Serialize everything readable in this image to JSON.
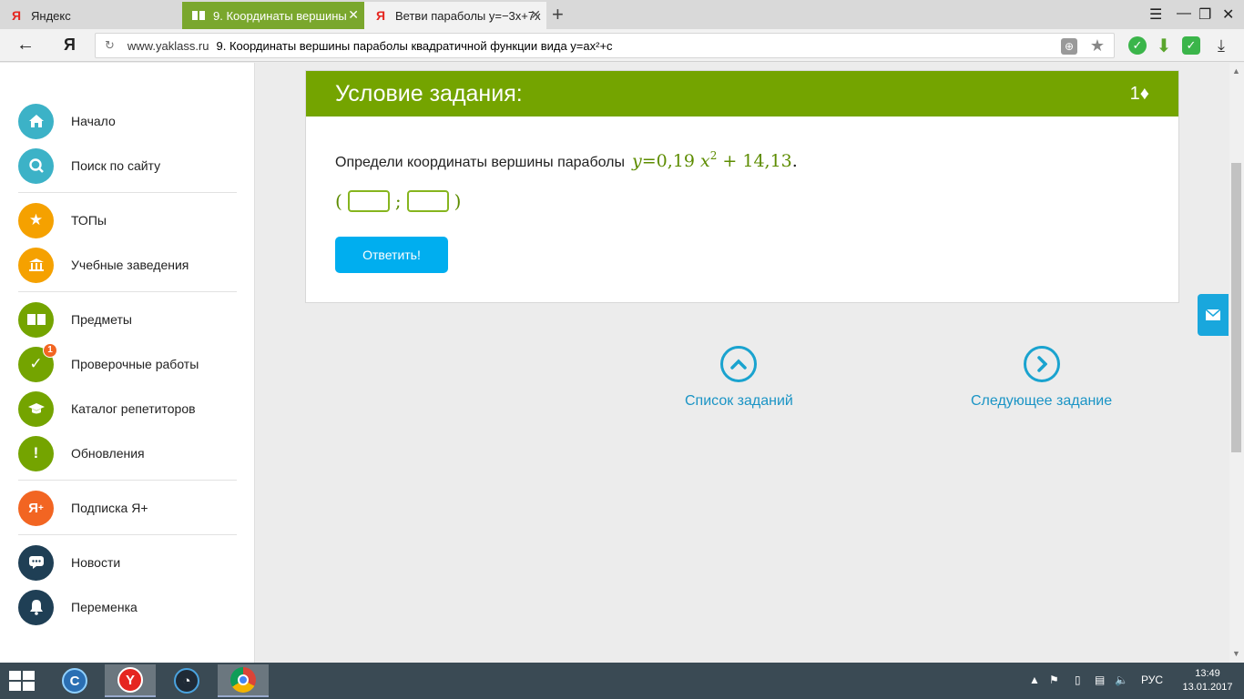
{
  "browser": {
    "tabs": [
      {
        "title": "Яндекс",
        "icon": "yandex-icon"
      },
      {
        "title": "9. Координаты вершины",
        "icon": "book-icon"
      },
      {
        "title": "Ветви параболы y=−3x+7x",
        "icon": "yandex-icon"
      }
    ],
    "new_tab_symbol": "+",
    "url_domain": "www.yaklass.ru",
    "url_title": "9. Координаты вершины параболы квадратичной функции вида y=ax²+c"
  },
  "sidebar": {
    "items": [
      {
        "label": "Начало",
        "icon": "home-icon",
        "color": "#3cb2c7"
      },
      {
        "label": "Поиск по сайту",
        "icon": "search-icon",
        "color": "#3cb2c7"
      },
      {
        "label": "ТОПы",
        "icon": "star-icon",
        "color": "#f5a100"
      },
      {
        "label": "Учебные заведения",
        "icon": "institution-icon",
        "color": "#f5a100"
      },
      {
        "label": "Предметы",
        "icon": "book-icon",
        "color": "#74a400"
      },
      {
        "label": "Проверочные работы",
        "icon": "check-icon",
        "color": "#74a400",
        "badge": "1"
      },
      {
        "label": "Каталог репетиторов",
        "icon": "graduation-cap-icon",
        "color": "#74a400"
      },
      {
        "label": "Обновления",
        "icon": "exclamation-icon",
        "color": "#74a400"
      },
      {
        "label": "Подписка Я+",
        "icon": "ya-plus-icon",
        "color": "#f26522"
      },
      {
        "label": "Новости",
        "icon": "chat-icon",
        "color": "#1f3f55"
      },
      {
        "label": "Переменка",
        "icon": "bell-icon",
        "color": "#1f3f55"
      }
    ]
  },
  "task": {
    "title": "Условие задания:",
    "points": "1♦",
    "question": "Определи координаты вершины параболы",
    "formula": {
      "y": "y",
      "eq": "=0,19",
      "x": "x",
      "exp": "2",
      "rest": "+ 14,13",
      "period": "."
    },
    "answer": {
      "open": "(",
      "sep": ";",
      "close": ")"
    },
    "submit_label": "Ответить!"
  },
  "navigation": {
    "task_list_label": "Список заданий",
    "next_task_label": "Следующее задание"
  },
  "taskbar": {
    "language": "РУС",
    "time": "13:49",
    "date": "13.01.2017"
  }
}
